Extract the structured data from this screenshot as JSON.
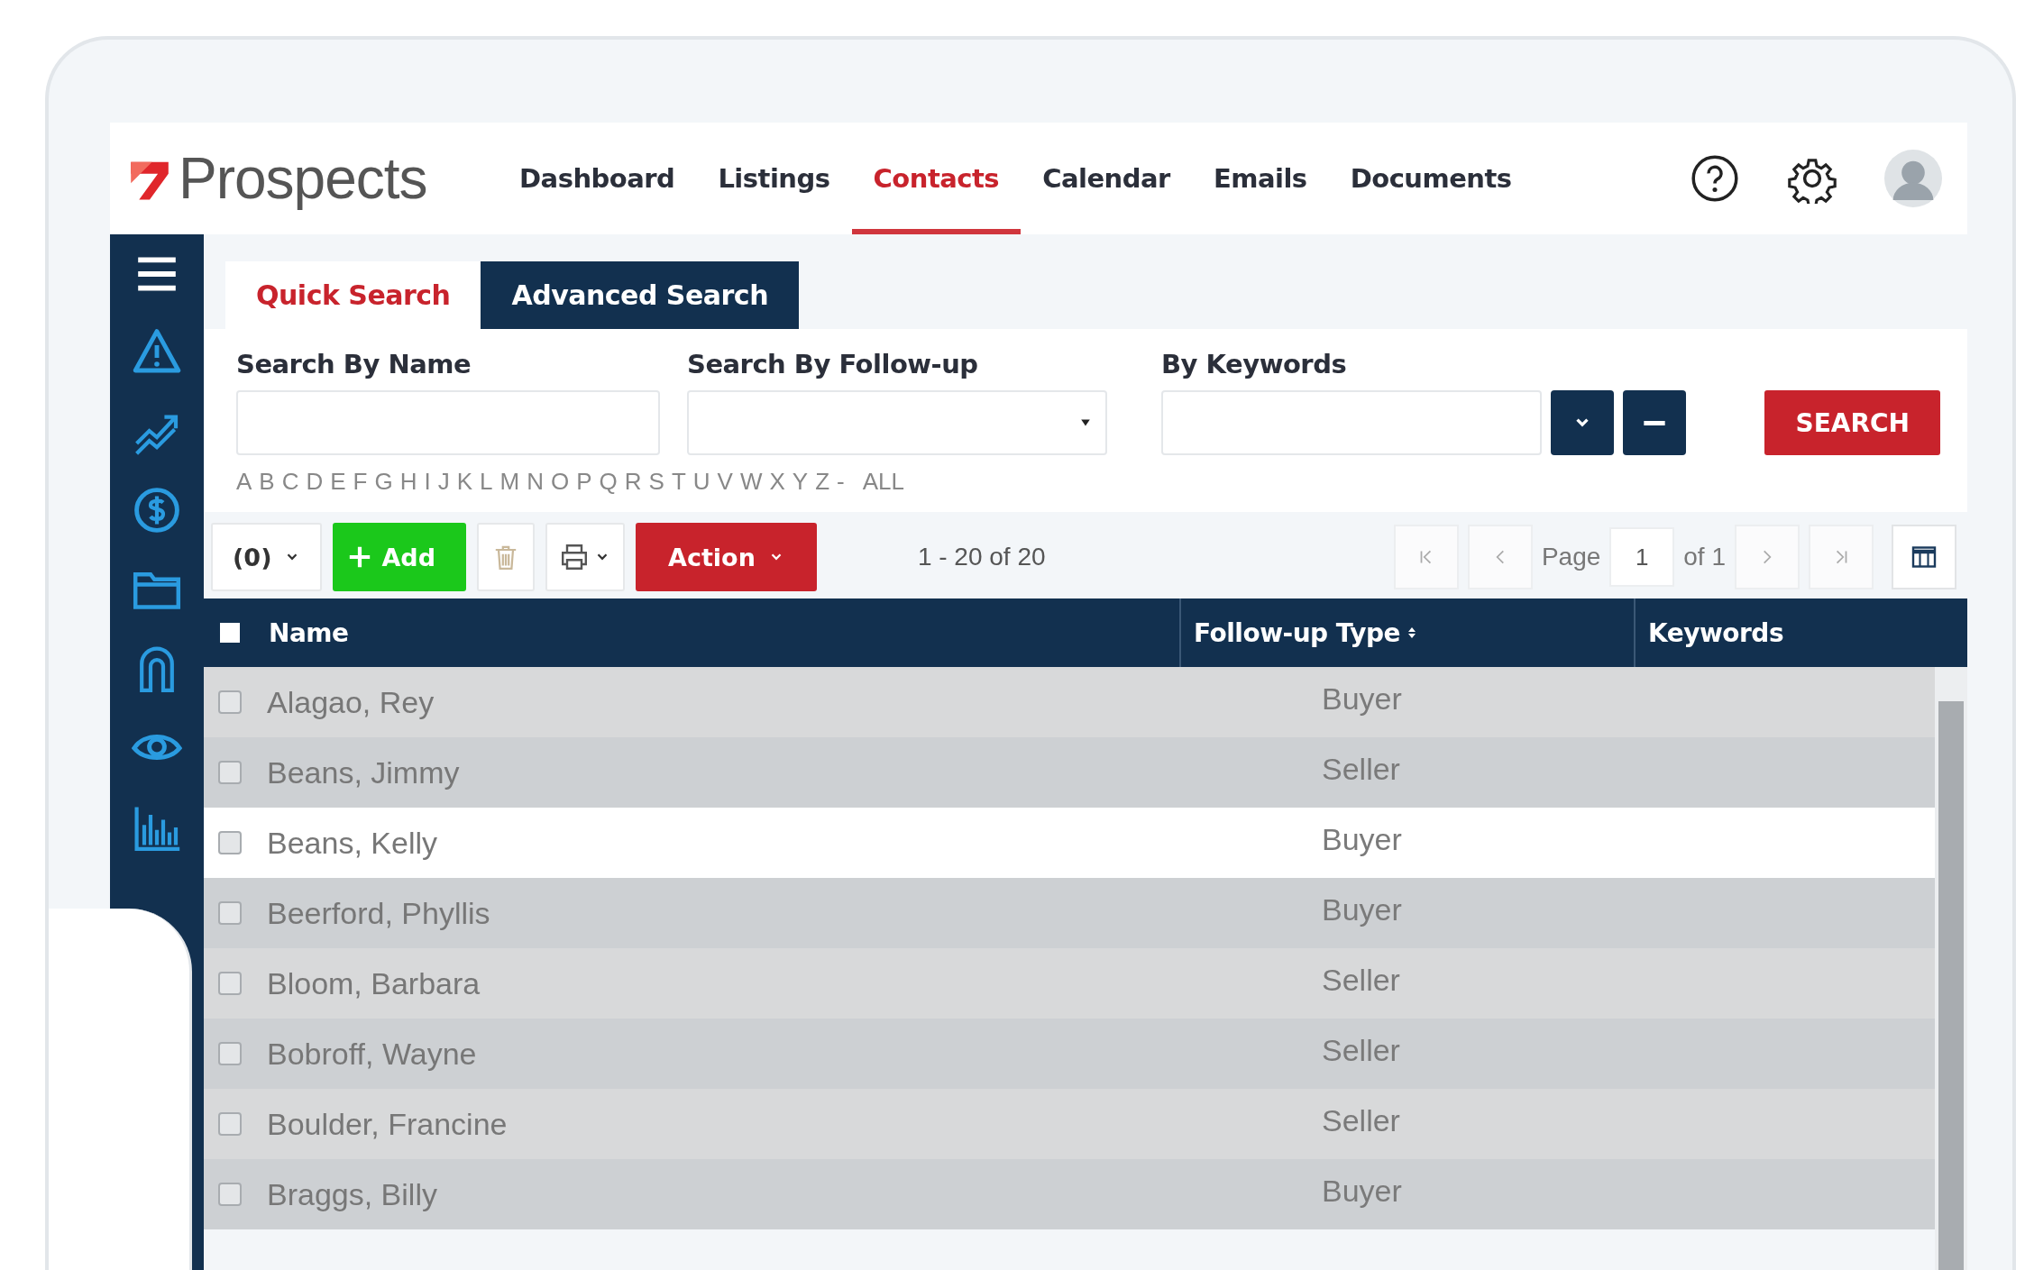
{
  "brand": {
    "name": "Prospects"
  },
  "nav": [
    {
      "label": "Dashboard",
      "selected": false
    },
    {
      "label": "Listings",
      "selected": false
    },
    {
      "label": "Contacts",
      "selected": true
    },
    {
      "label": "Calendar",
      "selected": false
    },
    {
      "label": "Emails",
      "selected": false
    },
    {
      "label": "Documents",
      "selected": false
    }
  ],
  "tabs": [
    {
      "label": "Quick Search",
      "selected": true
    },
    {
      "label": "Advanced Search",
      "selected": false
    }
  ],
  "search": {
    "fields": [
      {
        "label": "Search By Name",
        "kind": "text"
      },
      {
        "label": "Search By Follow-up",
        "kind": "select"
      },
      {
        "label": "By Keywords",
        "kind": "keywords"
      }
    ],
    "button": "SEARCH",
    "letters": [
      "A",
      "B",
      "C",
      "D",
      "E",
      "F",
      "G",
      "H",
      "I",
      "J",
      "K",
      "L",
      "M",
      "N",
      "O",
      "P",
      "Q",
      "R",
      "S",
      "T",
      "U",
      "V",
      "W",
      "X",
      "Y",
      "Z"
    ],
    "separator": "-",
    "all": "ALL"
  },
  "toolbar": {
    "selected_count": "(0)",
    "add": "Add",
    "action": "Action",
    "range": "1 - 20 of 20",
    "page_label": "Page",
    "page": "1",
    "page_of": "of 1"
  },
  "table": {
    "select_all": {
      "checked": false
    },
    "columns": [
      {
        "label": "Name",
        "sortable": false
      },
      {
        "label": "Follow-up Type",
        "sortable": true
      },
      {
        "label": "Keywords",
        "sortable": false
      }
    ],
    "rows": [
      {
        "name": "Alagao, Rey",
        "type": "Buyer",
        "checked": false,
        "selected": false
      },
      {
        "name": "Beans, Jimmy",
        "type": "Seller",
        "checked": false,
        "selected": false
      },
      {
        "name": "Beans, Kelly",
        "type": "Buyer",
        "checked": false,
        "selected": true
      },
      {
        "name": "Beerford, Phyllis",
        "type": "Buyer",
        "checked": false,
        "selected": false
      },
      {
        "name": "Bloom, Barbara",
        "type": "Seller",
        "checked": false,
        "selected": false
      },
      {
        "name": "Bobroff, Wayne",
        "type": "Seller",
        "checked": false,
        "selected": false
      },
      {
        "name": "Boulder, Francine",
        "type": "Seller",
        "checked": false,
        "selected": false
      },
      {
        "name": "Braggs, Billy",
        "type": "Buyer",
        "checked": false,
        "selected": false
      }
    ]
  }
}
